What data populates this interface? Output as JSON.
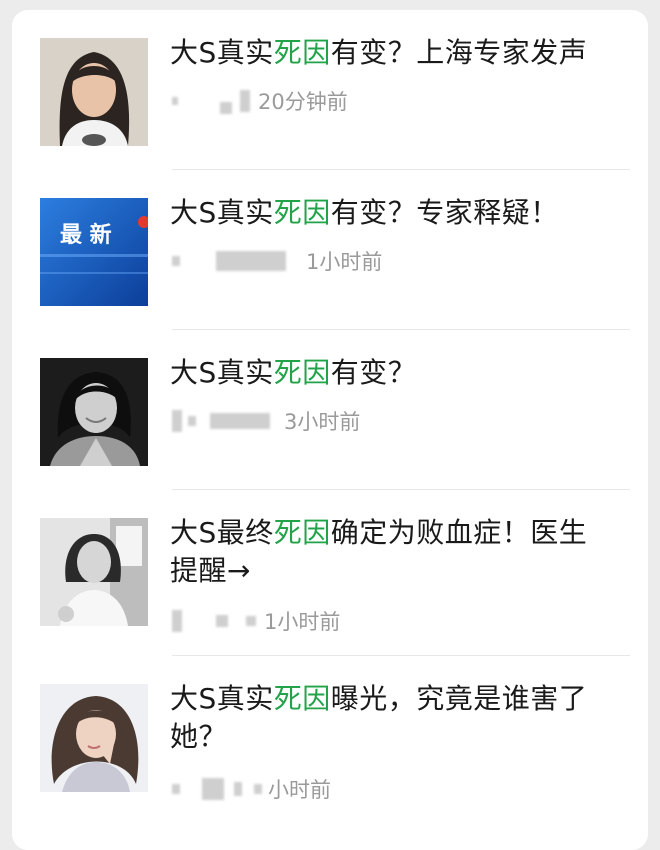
{
  "feed": {
    "items": [
      {
        "title_pre": "大S真实",
        "title_kw": "死因",
        "title_post": "有变？上海专家发声",
        "time": "20分钟前",
        "thumb_icon": "portrait-young-woman"
      },
      {
        "title_pre": "大S真实",
        "title_kw": "死因",
        "title_post": "有变？专家释疑！",
        "time": "1小时前",
        "thumb_icon": "news-banner",
        "thumb_text": "最 新"
      },
      {
        "title_pre": "大S真实",
        "title_kw": "死因",
        "title_post": "有变？",
        "time": "3小时前",
        "thumb_icon": "portrait-smiling-woman"
      },
      {
        "title_pre": "大S最终",
        "title_kw": "死因",
        "title_post": "确定为败血症！医生提醒→",
        "time": "1小时前",
        "thumb_icon": "portrait-woman-white-dress"
      },
      {
        "title_pre": "大S真实",
        "title_kw": "死因",
        "title_post": "曝光，究竟是谁害了她？",
        "time": "小时前",
        "thumb_icon": "portrait-woman-hand-face"
      }
    ]
  },
  "colors": {
    "keyword_green": "#22a34a",
    "title_text": "#1a1a1a",
    "meta_gray": "#9a9a9a",
    "news_blue": "#1f5fb8"
  }
}
